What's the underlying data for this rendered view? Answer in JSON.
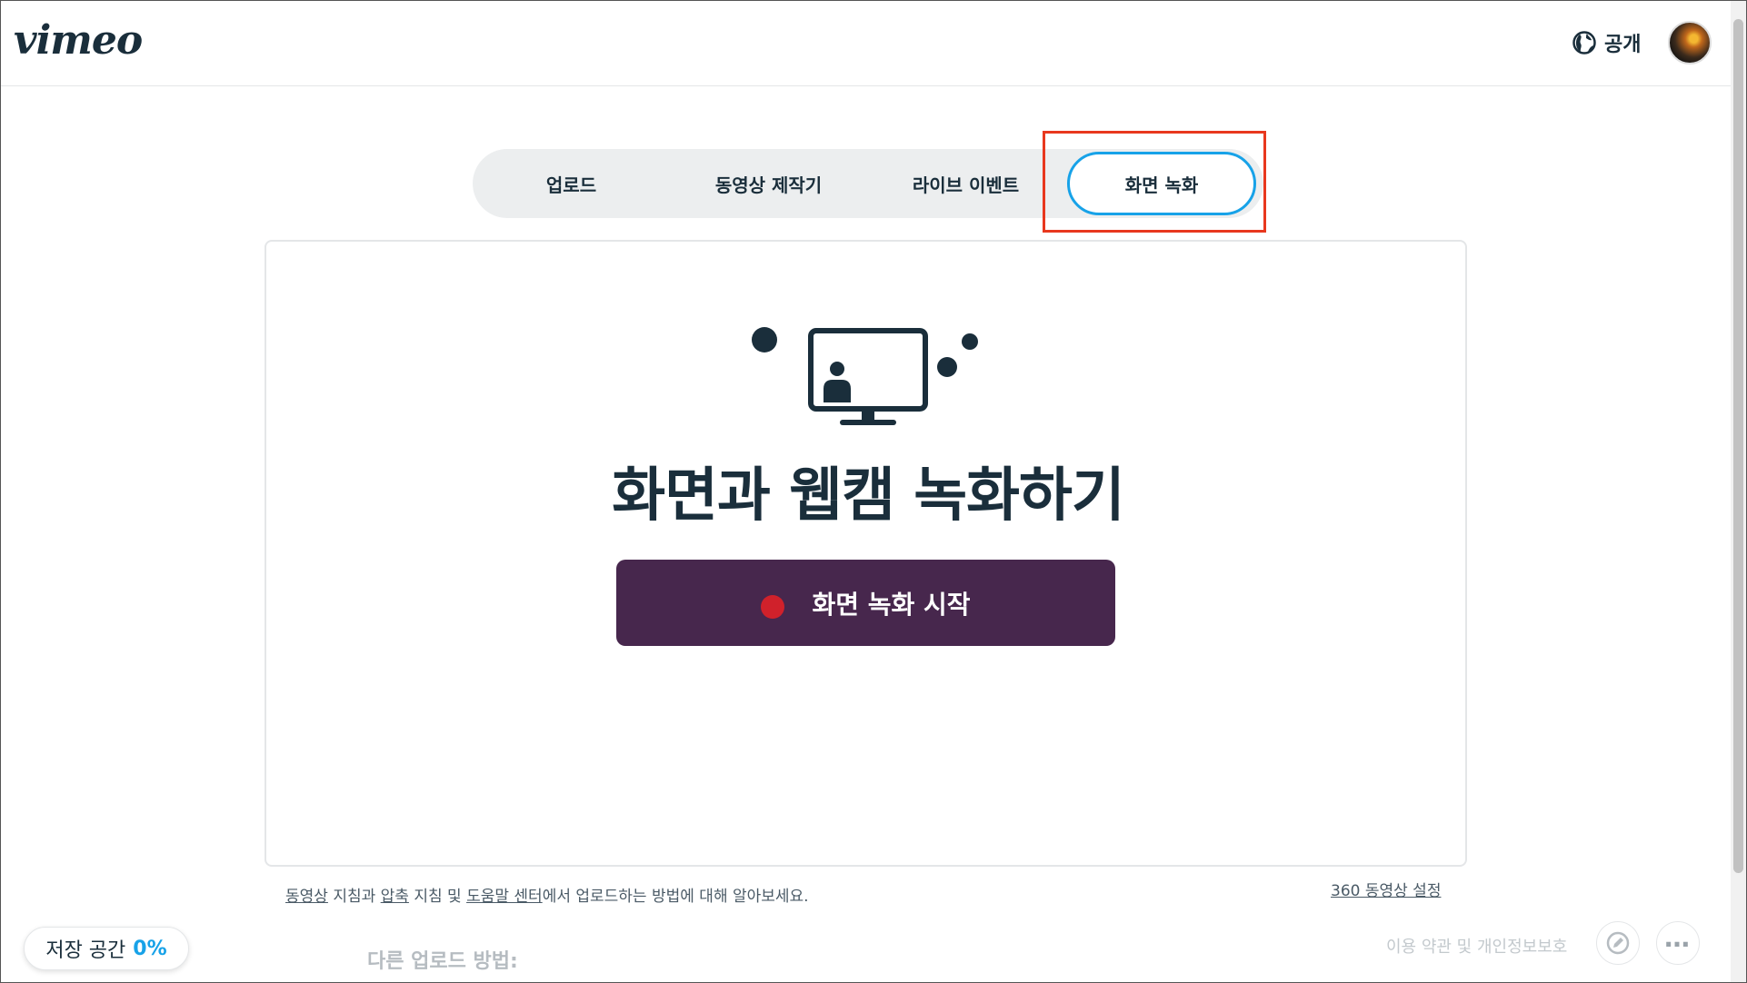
{
  "header": {
    "logo": "vimeo",
    "privacy_label": "공개"
  },
  "tabs": [
    {
      "label": "업로드"
    },
    {
      "label": "동영상 제작기"
    },
    {
      "label": "라이브 이벤트"
    },
    {
      "label": "화면 녹화",
      "active": true
    }
  ],
  "main": {
    "headline": "화면과 웹캠 녹화하기",
    "record_button_label": "화면 녹화 시작"
  },
  "help": {
    "link_videos": "동영상",
    "text_1": " 지침과 ",
    "link_compression": "압축",
    "text_2": " 지침 및 ",
    "link_help_center": "도움말 센터",
    "text_3": "에서 업로드하는 방법에 대해 알아보세요.",
    "link_360": "360 동영상 설정"
  },
  "storage": {
    "label": "저장 공간",
    "percent": "0%"
  },
  "other_upload_heading": "다른 업로드 방법:",
  "footer": {
    "terms_label": "이용 약관 및 개인정보보호"
  },
  "colors": {
    "accent_blue": "#17a2e8",
    "record_button_bg": "#47274d",
    "record_dot": "#d0212b",
    "highlight_box": "#e8381e",
    "text_dark": "#1a2e3b"
  },
  "icons": {
    "privacy": "globe-icon",
    "record": "record-dot-icon",
    "illustration": "monitor-person-icon",
    "edit": "edit-icon",
    "more": "more-icon"
  }
}
